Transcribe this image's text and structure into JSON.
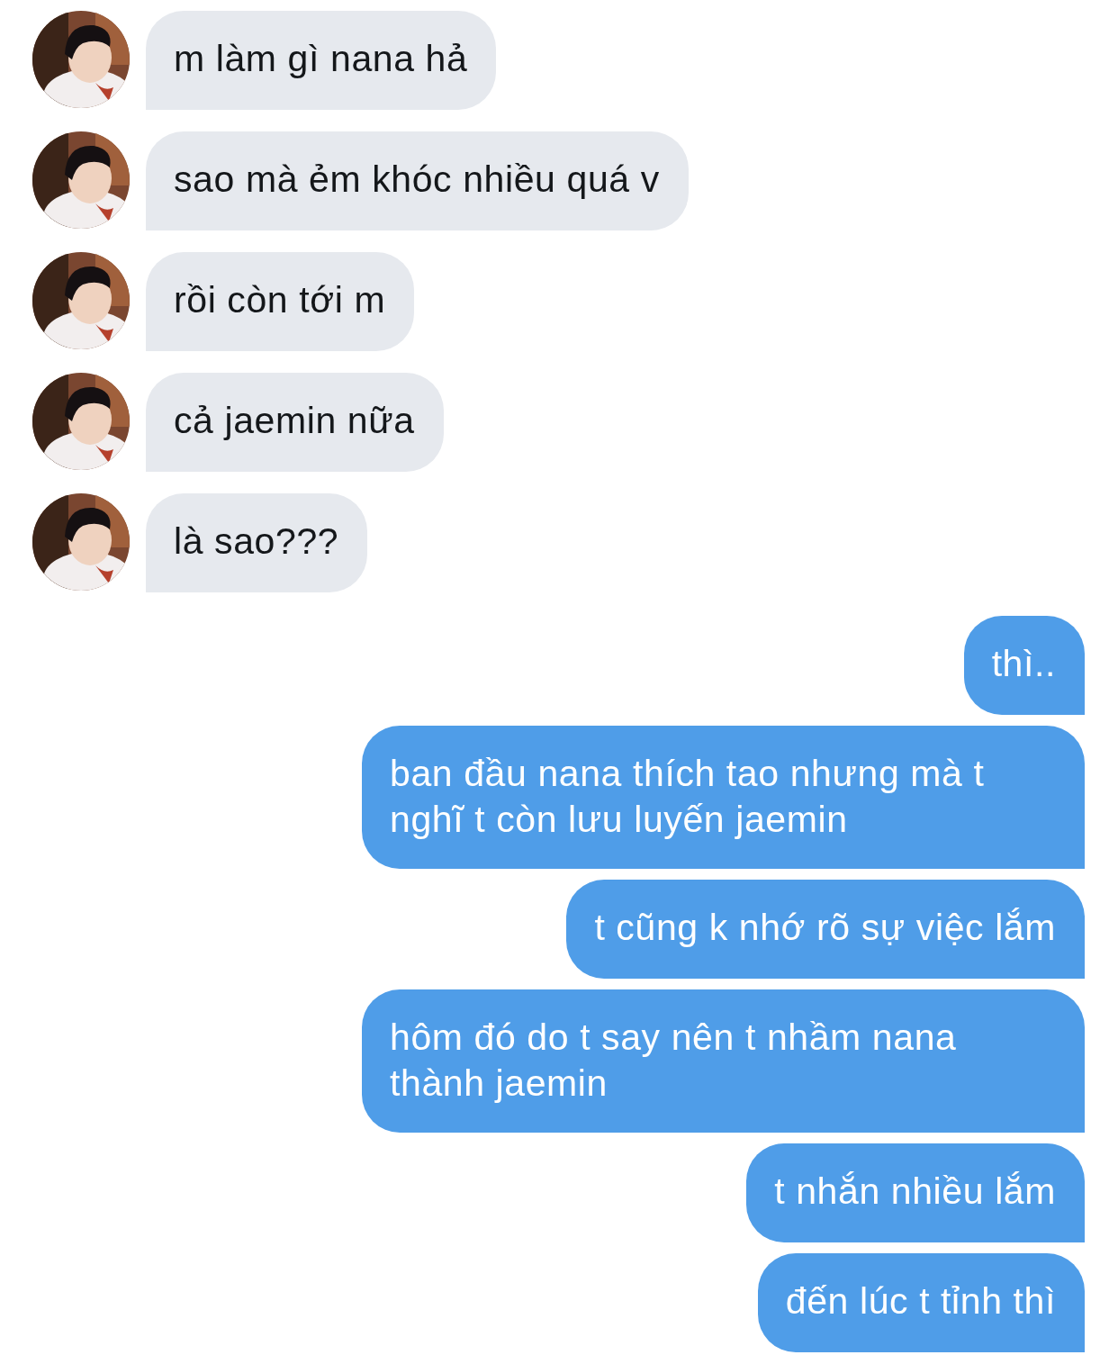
{
  "messages": [
    {
      "kind": "incoming",
      "text": "m làm gì nana hả"
    },
    {
      "kind": "incoming",
      "text": "sao mà ẻm khóc nhiều quá v"
    },
    {
      "kind": "incoming",
      "text": "rồi còn tới m"
    },
    {
      "kind": "incoming",
      "text": "cả jaemin nữa"
    },
    {
      "kind": "incoming",
      "text": "là sao???"
    },
    {
      "kind": "outgoing",
      "text": "thì.."
    },
    {
      "kind": "outgoing",
      "text": "ban đầu nana thích tao nhưng mà t nghĩ t còn lưu luyến jaemin"
    },
    {
      "kind": "outgoing",
      "text": "t cũng k nhớ rõ sự việc lắm"
    },
    {
      "kind": "outgoing",
      "text": "hôm đó do t say nên t nhầm nana thành jaemin"
    },
    {
      "kind": "outgoing",
      "text": "t nhắn nhiều lắm"
    },
    {
      "kind": "outgoing",
      "text": "đến lúc t tỉnh thì"
    }
  ]
}
